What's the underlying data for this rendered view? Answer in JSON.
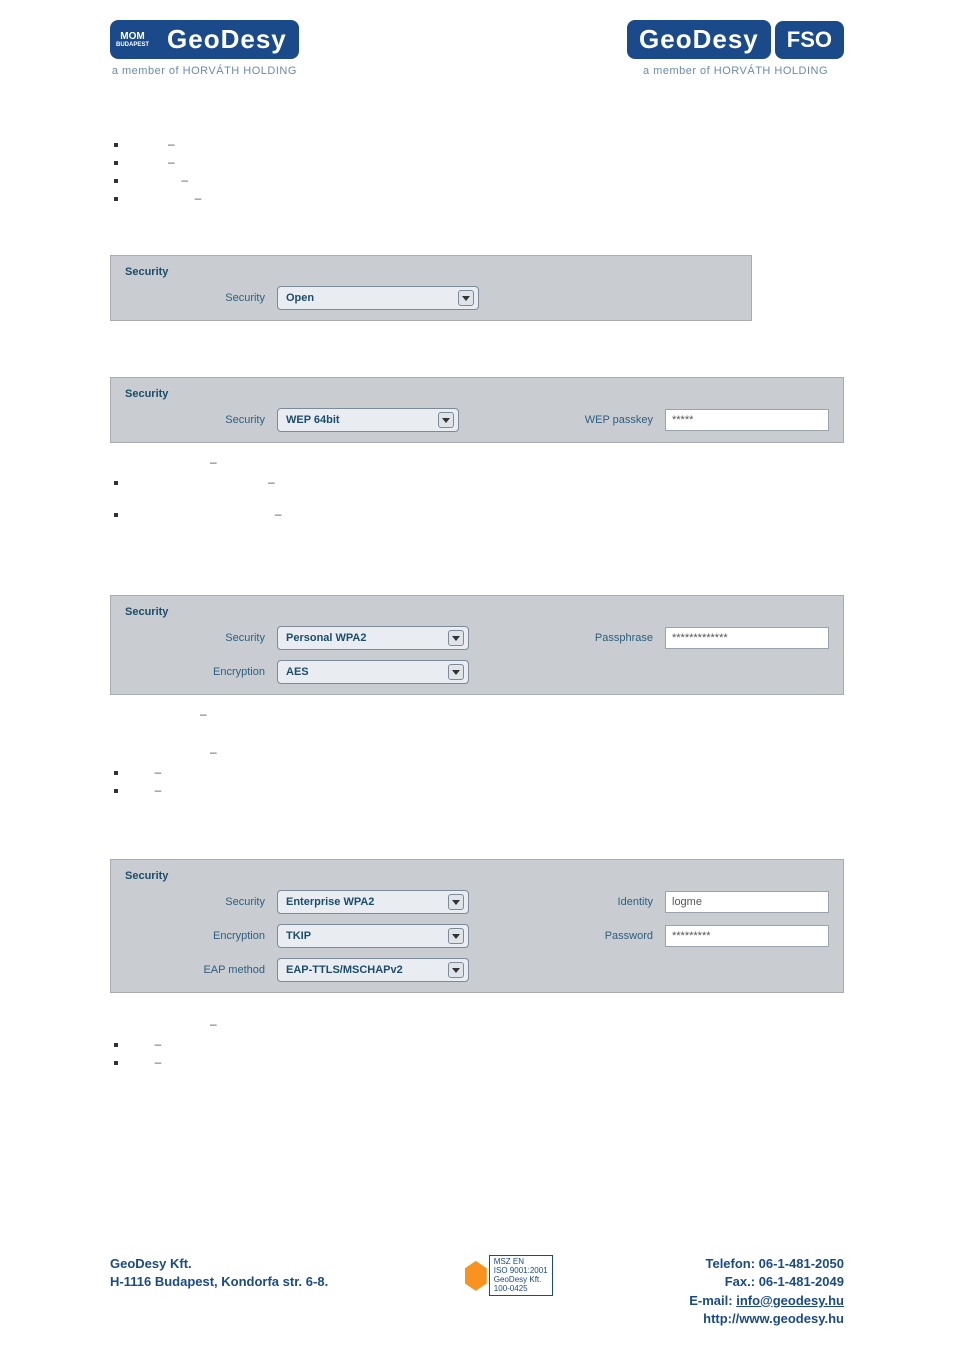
{
  "header": {
    "logo_left_mom_top": "MOM",
    "logo_left_mom_bottom": "BUDAPEST",
    "logo_geo": "GeoDesy",
    "logo_fso": "FSO",
    "logo_sub": "a member of HORVÁTH HOLDING"
  },
  "labels": {
    "security_title": "Security",
    "security_label": "Security",
    "encryption_label": "Encryption",
    "eap_label": "EAP method",
    "wep_passkey": "WEP passkey",
    "passphrase": "Passphrase",
    "identity": "Identity",
    "password": "Password"
  },
  "panel_open": {
    "security": "Open"
  },
  "panel_wep": {
    "security": "WEP 64bit",
    "wep_passkey": "*****"
  },
  "panel_pwpa2": {
    "security": "Personal WPA2",
    "encryption": "AES",
    "passphrase": "*************"
  },
  "panel_ewpa2": {
    "security": "Enterprise WPA2",
    "encryption": "TKIP",
    "eap": "EAP-TTLS/MSCHAPv2",
    "identity": "logme",
    "password": "*********"
  },
  "footer": {
    "company": "GeoDesy Kft.",
    "address": "H-1116 Budapest, Kondorfa str. 6-8.",
    "cert1": "MSZ EN",
    "cert2": "ISO 9001:2001",
    "cert3": "GeoDesy Kft.",
    "cert4": "100-0425",
    "phone": "Telefon: 06-1-481-2050",
    "fax": "Fax.: 06-1-481-2049",
    "email_label": "E-mail: ",
    "email": "info@geodesy.hu",
    "web": "http://www.geodesy.hu"
  }
}
